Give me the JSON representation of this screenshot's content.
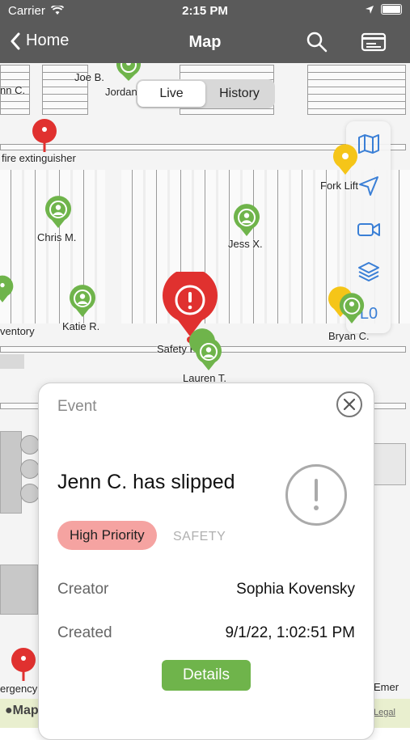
{
  "status_bar": {
    "carrier": "Carrier",
    "time": "2:15 PM"
  },
  "nav": {
    "back_label": "Home",
    "title": "Map"
  },
  "segment": {
    "options": [
      "Live",
      "History"
    ],
    "selected": "Live"
  },
  "toolbar": {
    "level_label": "L0"
  },
  "map_labels": {
    "fire_extinguisher": "fire extinguisher",
    "joe": "Joe B.",
    "jordan": "Jordan",
    "jenn_partial": "nn C.",
    "chris": "Chris M.",
    "jess": "Jess X.",
    "katie": "Katie R.",
    "inventory": "ventory",
    "fork_lift": "Fork Lift",
    "bryan": "Bryan C.",
    "safety": "Safety Pot",
    "lauren": "Lauren T.",
    "emergency_left": "ergency",
    "emergency_right": "Emer",
    "apple_maps": "Maps",
    "legal": "Legal"
  },
  "event_card": {
    "section_label": "Event",
    "title": "Jenn C. has slipped",
    "priority": "High Priority",
    "category": "SAFETY",
    "creator_label": "Creator",
    "creator_value": "Sophia Kovensky",
    "created_label": "Created",
    "created_value": "9/1/22, 1:02:51 PM",
    "details_label": "Details"
  },
  "colors": {
    "accent_green": "#6fb44b",
    "pin_red": "#e0312f",
    "priority_pink": "#f5a3a1",
    "nav_grey": "#5a5a5a",
    "tool_blue": "#3a7fd6"
  }
}
